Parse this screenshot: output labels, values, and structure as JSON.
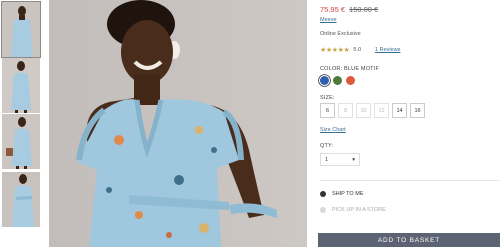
{
  "thumbnails": [
    {
      "name": "thumb-front",
      "active": true
    },
    {
      "name": "thumb-side",
      "active": false
    },
    {
      "name": "thumb-back",
      "active": false
    },
    {
      "name": "thumb-full",
      "active": false
    }
  ],
  "product": {
    "sale_price": "75.95 €",
    "original_price": "150.00 €",
    "modal_link": "Meeve",
    "exclusive": "Online Exclusive",
    "stars": "★★★★★",
    "rating_value": "5.0",
    "reviews_link": "1 Reviews"
  },
  "color": {
    "label": "COLOR: BLUE MOTIF",
    "swatches": [
      {
        "name": "blue",
        "hex": "#2f5fae",
        "selected": true
      },
      {
        "name": "green",
        "hex": "#4e7a3a",
        "selected": false
      },
      {
        "name": "orange",
        "hex": "#de5a3c",
        "selected": false
      }
    ]
  },
  "size": {
    "label": "SIZE:",
    "options": [
      {
        "label": "6",
        "available": true
      },
      {
        "label": "8",
        "available": false
      },
      {
        "label": "10",
        "available": false
      },
      {
        "label": "12",
        "available": false
      },
      {
        "label": "14",
        "available": true
      },
      {
        "label": "16",
        "available": true
      }
    ],
    "chart_link": "Size Chart"
  },
  "quantity": {
    "label": "QTY:",
    "value": "1",
    "arrow": "▾"
  },
  "delivery": {
    "ship_label": "SHIP TO ME",
    "pickup_label": "PICK UP IN A STORE"
  },
  "add_to_basket": "ADD TO BASKET",
  "colors": {
    "sale_red": "#d0483c",
    "link_blue": "#3a6f95",
    "button_gray": "#5c6373",
    "dress_blue": "#9fc7dd"
  }
}
